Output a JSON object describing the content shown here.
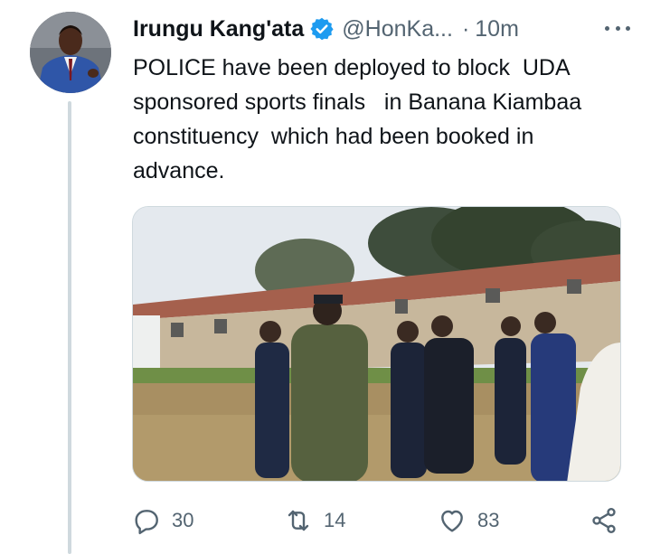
{
  "tweet": {
    "author_name": "Irungu Kang'ata",
    "handle": "@HonKa...",
    "separator": "·",
    "time_ago": "10m",
    "text": "POLICE have been deployed to block  UDA sponsored sports finals   in Banana Kiambaa constituency  which had been booked in advance.",
    "verified_color": "#1d9bf0"
  },
  "actions": {
    "reply_count": "30",
    "retweet_count": "14",
    "like_count": "83"
  },
  "colors": {
    "text_primary": "#0f1419",
    "text_secondary": "#536471",
    "border": "#cfd9de"
  }
}
